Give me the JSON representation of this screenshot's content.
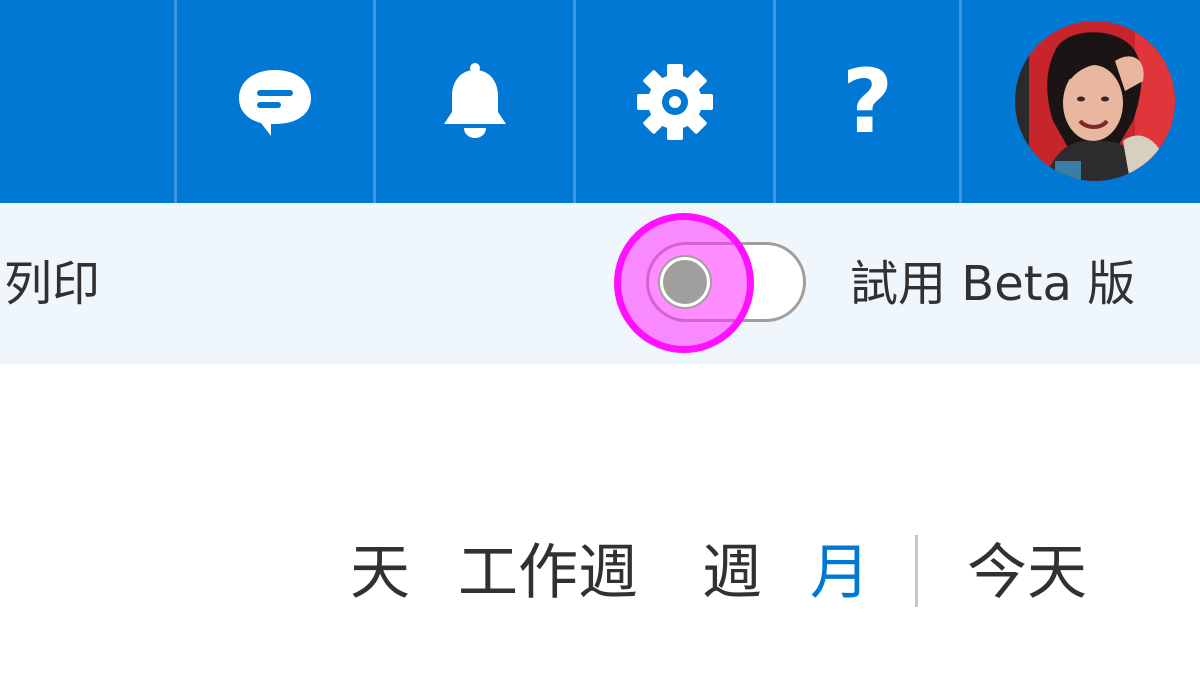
{
  "header": {
    "icons": [
      "chat-icon",
      "bell-icon",
      "gear-icon",
      "help-icon",
      "avatar"
    ],
    "help_glyph": "?",
    "accent_color": "#0078d4"
  },
  "command_bar": {
    "print_label": "列印",
    "beta_toggle": {
      "label": "試用 Beta 版",
      "state": "off"
    }
  },
  "view_switcher": {
    "items": [
      "天",
      "工作週",
      "週",
      "月"
    ],
    "active": "月",
    "today_label": "今天",
    "active_color": "#0078d4"
  }
}
